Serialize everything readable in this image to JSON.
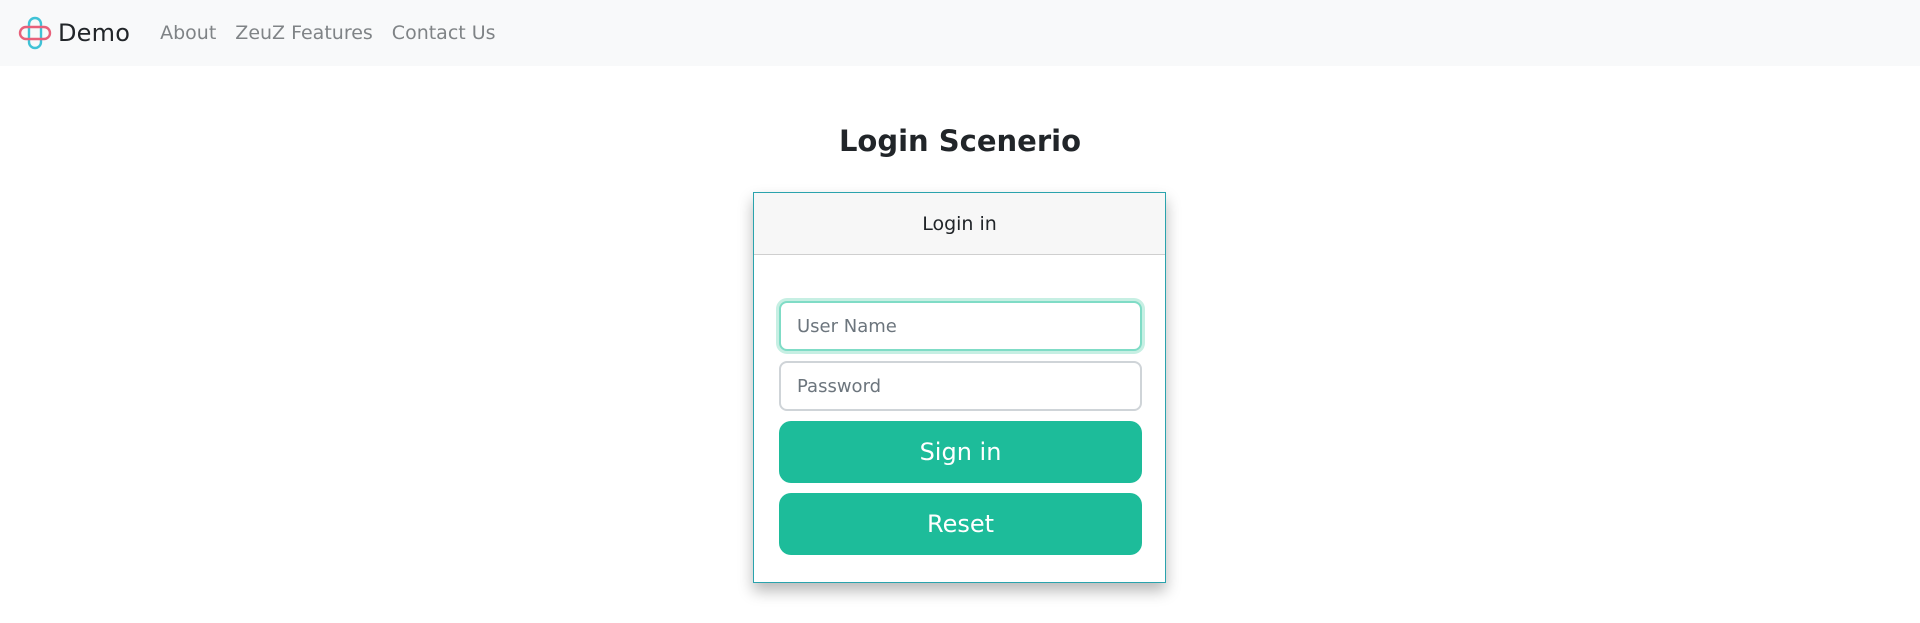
{
  "nav": {
    "brand": "Demo",
    "links": [
      "About",
      "ZeuZ Features",
      "Contact Us"
    ]
  },
  "page": {
    "title": "Login Scenerio"
  },
  "login_card": {
    "header": "Login in",
    "username_placeholder": "User Name",
    "username_value": "",
    "password_placeholder": "Password",
    "password_value": "",
    "sign_in_label": "Sign in",
    "reset_label": "Reset"
  },
  "colors": {
    "accent": "#1dbc9a",
    "card_border": "#2aa3ad",
    "navbar_bg": "#f8f9fa"
  },
  "icons": {
    "brand": "brand-logo-icon"
  }
}
